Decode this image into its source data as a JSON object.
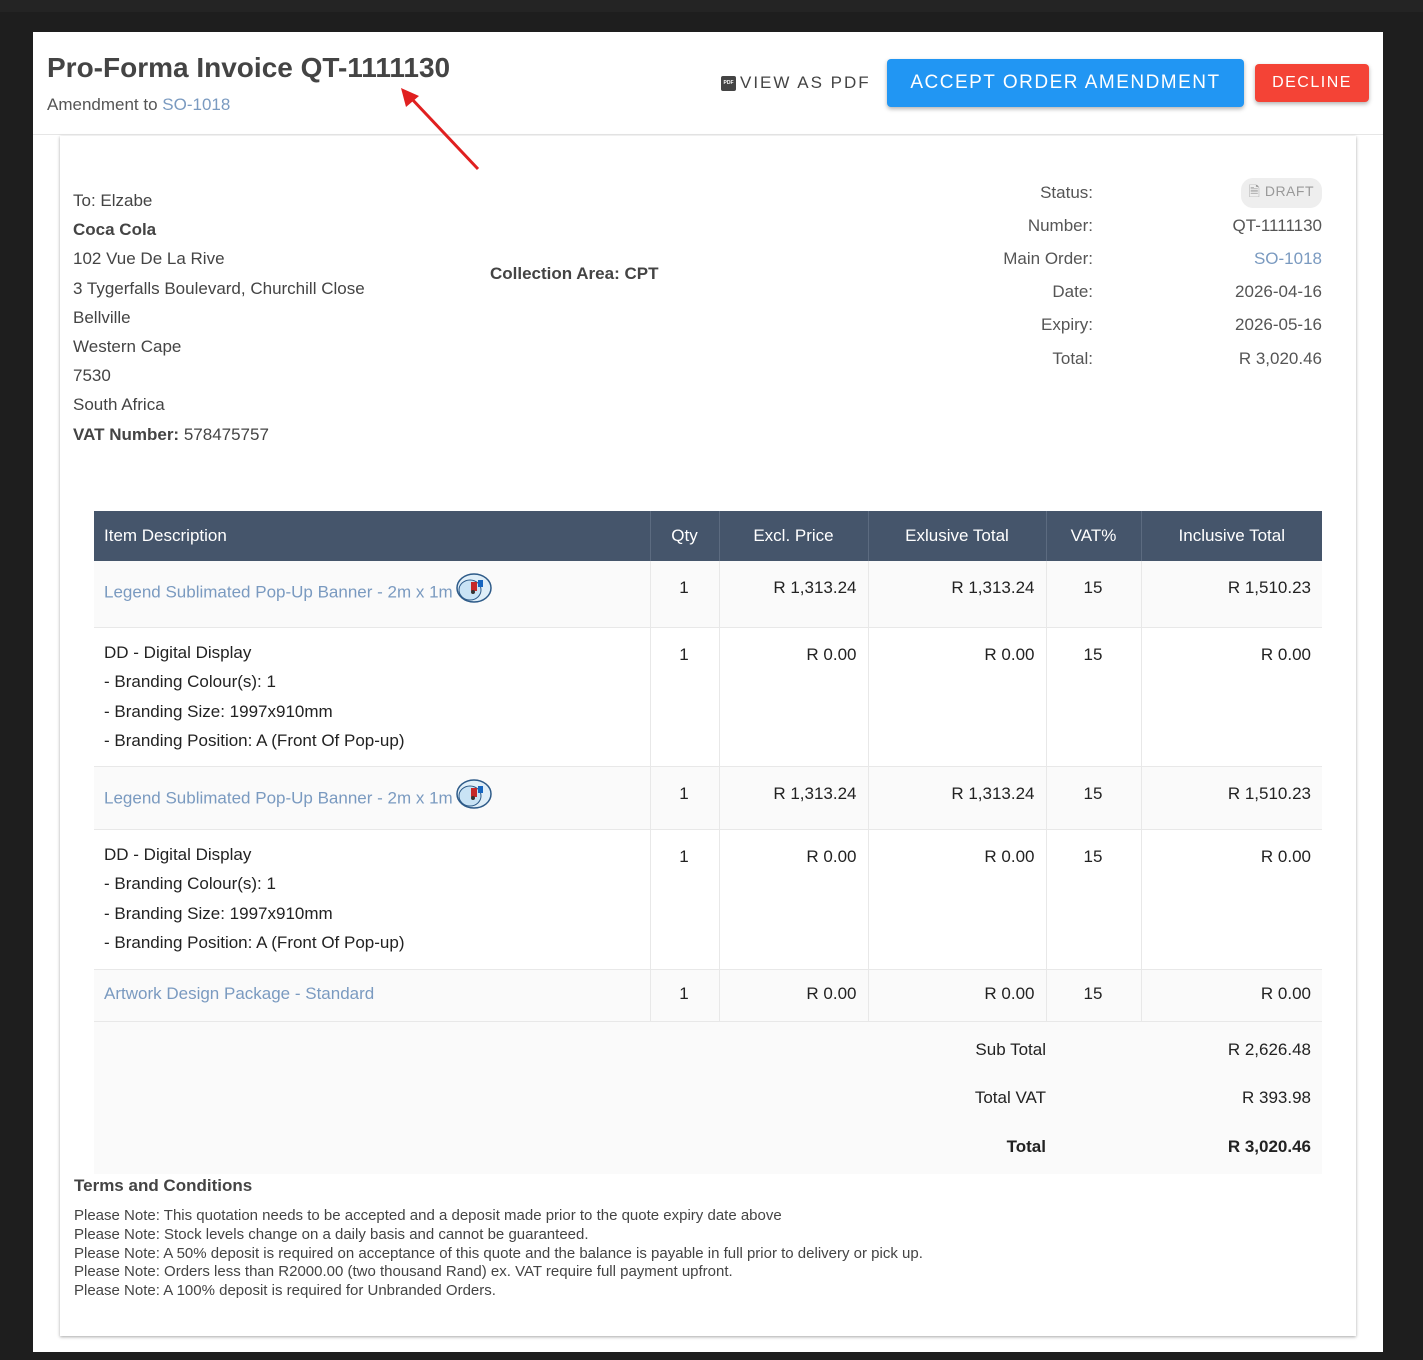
{
  "header": {
    "title": "Pro-Forma Invoice QT-1111130",
    "amendment_prefix": "Amendment to",
    "amendment_link": "SO-1018",
    "pdf_icon_text": "PDF",
    "view_pdf": "VIEW AS PDF",
    "accept": "ACCEPT ORDER AMENDMENT",
    "decline": "DECLINE"
  },
  "address": {
    "to": "To: Elzabe",
    "company": "Coca Cola",
    "lines": [
      "102 Vue De La Rive",
      "3 Tygerfalls Boulevard, Churchill Close",
      "Bellville",
      "Western Cape",
      "7530",
      "South Africa"
    ],
    "vat_label": "VAT Number:",
    "vat_value": "578475757"
  },
  "collection_area": "Collection Area: CPT",
  "meta": {
    "status_label": "Status:",
    "status_value": "DRAFT",
    "number_label": "Number:",
    "number_value": "QT-1111130",
    "main_order_label": "Main Order:",
    "main_order_value": "SO-1018",
    "date_label": "Date:",
    "date_value": "2026-04-16",
    "expiry_label": "Expiry:",
    "expiry_value": "2026-05-16",
    "total_label": "Total:",
    "total_value": "R 3,020.46"
  },
  "table": {
    "headers": [
      "Item Description",
      "Qty",
      "Excl. Price",
      "Exlusive Total",
      "VAT%",
      "Inclusive Total"
    ],
    "rows": [
      {
        "desc": "Legend Sublimated Pop-Up Banner - 2m x 1m",
        "qty": "1",
        "excl": "R 1,313.24",
        "ext": "R 1,313.24",
        "vat": "15",
        "inc": "R 1,510.23"
      },
      {
        "desc": "DD - Digital Display",
        "opt1": "- Branding Colour(s): 1",
        "opt2": "- Branding Size: 1997x910mm",
        "opt3": "- Branding Position: A (Front Of Pop-up)",
        "qty": "1",
        "excl": "R 0.00",
        "ext": "R 0.00",
        "vat": "15",
        "inc": "R 0.00"
      },
      {
        "desc": "Legend Sublimated Pop-Up Banner - 2m x 1m",
        "qty": "1",
        "excl": "R 1,313.24",
        "ext": "R 1,313.24",
        "vat": "15",
        "inc": "R 1,510.23"
      },
      {
        "desc": "DD - Digital Display",
        "opt1": "- Branding Colour(s): 1",
        "opt2": "- Branding Size: 1997x910mm",
        "opt3": "- Branding Position: A (Front Of Pop-up)",
        "qty": "1",
        "excl": "R 0.00",
        "ext": "R 0.00",
        "vat": "15",
        "inc": "R 0.00"
      },
      {
        "desc": "Artwork Design Package - Standard",
        "qty": "1",
        "excl": "R 0.00",
        "ext": "R 0.00",
        "vat": "15",
        "inc": "R 0.00"
      }
    ],
    "subtotal_label": "Sub Total",
    "subtotal_value": "R 2,626.48",
    "vat_label": "Total VAT",
    "vat_value": "R 393.98",
    "total_label": "Total",
    "total_value": "R 3,020.46"
  },
  "terms": {
    "heading": "Terms and Conditions",
    "lines": [
      "Please Note: This quotation needs to be accepted and a deposit made prior to the quote expiry date above",
      "Please Note: Stock levels change on a daily basis and cannot be guaranteed.",
      "Please Note: A 50% deposit is required on acceptance of this quote and the balance is payable in full prior to delivery or pick up.",
      "Please Note: Orders less than R2000.00 (two thousand Rand) ex. VAT require full payment upfront.",
      "Please Note: A 100% deposit is required for Unbranded Orders."
    ]
  },
  "colors": {
    "accent": "#2196f3",
    "danger": "#f44336",
    "table_header": "#45556b",
    "link": "#7a9ac0",
    "annotation_arrow": "#e02020"
  }
}
